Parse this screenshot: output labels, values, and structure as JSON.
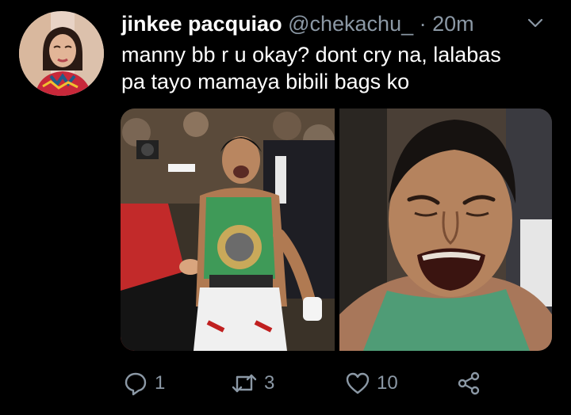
{
  "tweet": {
    "author": {
      "display_name": "jinkee pacquiao",
      "handle": "@chekachu_",
      "time_separator": "·",
      "time": "20m"
    },
    "text_lines": [
      "manny bb r u okay? dont cry na, lalabas",
      "pa tayo mamaya bibili bags ko"
    ],
    "media": [
      {
        "icon": "photo-boxer-crying-with-belt"
      },
      {
        "icon": "photo-boxer-crying-closeup"
      }
    ]
  },
  "actions": {
    "reply": {
      "icon": "reply-icon",
      "count": "1"
    },
    "retweet": {
      "icon": "retweet-icon",
      "count": "3"
    },
    "like": {
      "icon": "heart-icon",
      "count": "10"
    },
    "share": {
      "icon": "share-icon"
    }
  },
  "colors": {
    "background": "#000000",
    "text_primary": "#ffffff",
    "text_secondary": "#8b98a5"
  }
}
